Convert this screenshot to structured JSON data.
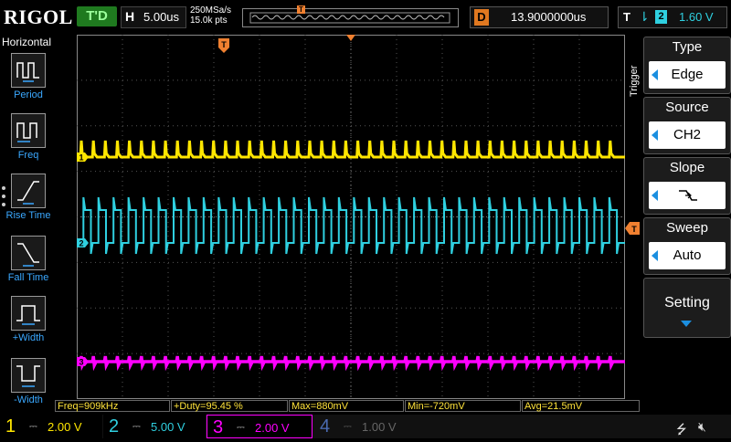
{
  "header": {
    "brand": "RIGOL",
    "run_state": "T'D",
    "horizontal_label": "H",
    "timebase": "5.00us",
    "sample_rate": "250MSa/s",
    "memory_points": "15.0k pts",
    "delay_label": "D",
    "delay_value": "13.9000000us",
    "trigger_label": "T",
    "trigger_source_channel": "2",
    "trigger_level": "1.60 V"
  },
  "left_panel": {
    "title": "Horizontal",
    "items": [
      {
        "label": "Period",
        "icon": "period-icon"
      },
      {
        "label": "Freq",
        "icon": "freq-icon"
      },
      {
        "label": "Rise Time",
        "icon": "rise-time-icon"
      },
      {
        "label": "Fall Time",
        "icon": "fall-time-icon"
      },
      {
        "label": "+Width",
        "icon": "positive-width-icon"
      },
      {
        "label": "-Width",
        "icon": "negative-width-icon"
      }
    ]
  },
  "side_label": "Trigger",
  "right_menu": {
    "items": [
      {
        "title": "Type",
        "value": "Edge"
      },
      {
        "title": "Source",
        "value": "CH2"
      },
      {
        "title": "Slope",
        "value": "falling-edge-icon"
      },
      {
        "title": "Sweep",
        "value": "Auto"
      }
    ],
    "setting_label": "Setting"
  },
  "measurements": [
    "Freq=909kHz",
    "+Duty=95.45 %",
    "Max=880mV",
    "Min=-720mV",
    "Avg=21.5mV"
  ],
  "channels": [
    {
      "num": "1",
      "scale": "2.00 V",
      "color": "#ffe600",
      "active": true
    },
    {
      "num": "2",
      "scale": "5.00 V",
      "color": "#2fd0e0",
      "active": true
    },
    {
      "num": "3",
      "scale": "2.00 V",
      "color": "#ff00ff",
      "active": true
    },
    {
      "num": "4",
      "scale": "1.00 V",
      "color": "#4a6ab0",
      "active": false
    }
  ],
  "colors": {
    "ch1": "#ffe600",
    "ch2": "#2fd0e0",
    "ch3": "#ff00ff",
    "trigger_marker": "#f08030",
    "grid": "#555555"
  }
}
